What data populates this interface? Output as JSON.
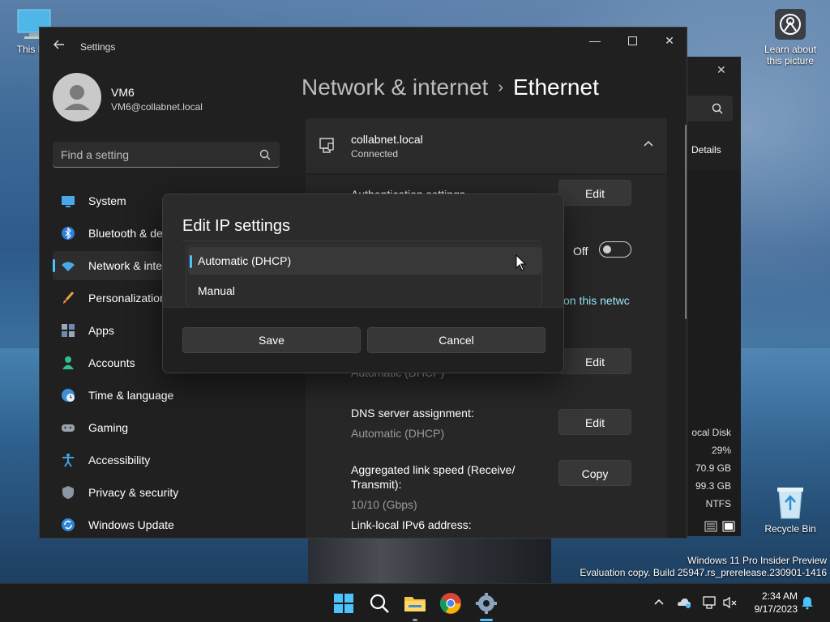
{
  "desktop": {
    "this_pc_label": "This PC",
    "learn_label_line1": "Learn about",
    "learn_label_line2": "this picture",
    "recycle_label": "Recycle Bin"
  },
  "settings": {
    "app_title": "Settings",
    "user_name": "VM6",
    "user_email": "VM6@collabnet.local",
    "search_placeholder": "Find a setting",
    "nav": [
      {
        "label": "System",
        "icon": "monitor-icon"
      },
      {
        "label": "Bluetooth & devices",
        "icon": "bluetooth-icon"
      },
      {
        "label": "Network & internet",
        "icon": "wifi-icon",
        "active": true
      },
      {
        "label": "Personalization",
        "icon": "brush-icon"
      },
      {
        "label": "Apps",
        "icon": "apps-icon"
      },
      {
        "label": "Accounts",
        "icon": "person-icon"
      },
      {
        "label": "Time & language",
        "icon": "globe-clock-icon"
      },
      {
        "label": "Gaming",
        "icon": "gamepad-icon"
      },
      {
        "label": "Accessibility",
        "icon": "accessibility-icon"
      },
      {
        "label": "Privacy & security",
        "icon": "shield-icon"
      },
      {
        "label": "Windows Update",
        "icon": "update-icon"
      }
    ],
    "breadcrumb_parent": "Network & internet",
    "breadcrumb_sep": "›",
    "breadcrumb_current": "Ethernet",
    "ethernet": {
      "name": "collabnet.local",
      "status": "Connected"
    },
    "rows": {
      "auth_label": "Authentication settings",
      "edit_label": "Edit",
      "metered_off": "Off",
      "link_text": "on this netwc",
      "ip_value": "Automatic (DHCP)",
      "dns_label": "DNS server assignment:",
      "dns_value": "Automatic (DHCP)",
      "speed_label_1": "Aggregated link speed (Receive/",
      "speed_label_2": "Transmit):",
      "speed_value": "10/10 (Gbps)",
      "copy_label": "Copy",
      "ipv6_label": "Link-local IPv6 address:"
    }
  },
  "explorer": {
    "details": "Details",
    "local_disk": "ocal Disk",
    "pct": "29%",
    "free": "70.9 GB",
    "total": "99.3 GB",
    "fs": "NTFS"
  },
  "dialog": {
    "title": "Edit IP settings",
    "options": [
      "Automatic (DHCP)",
      "Manual"
    ],
    "selected_index": 0,
    "save_label": "Save",
    "cancel_label": "Cancel"
  },
  "watermark": {
    "line1": "Windows 11 Pro Insider Preview",
    "line2": "Evaluation copy. Build 25947.rs_prerelease.230901-1416"
  },
  "taskbar": {
    "time": "2:34 AM",
    "date": "9/17/2023"
  },
  "colors": {
    "accent": "#4cc2ff",
    "window_bg": "#202020",
    "card_bg": "#2b2b2b"
  }
}
